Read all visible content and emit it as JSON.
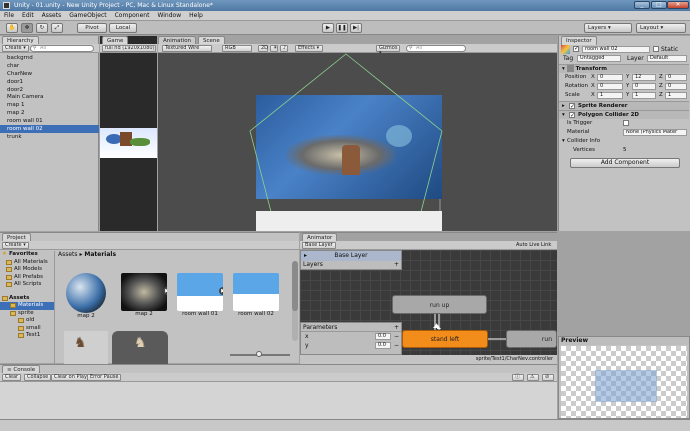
{
  "window": {
    "title": "Unity - 01.unity - New Unity Project - PC, Mac & Linux Standalone*"
  },
  "menu": [
    "File",
    "Edit",
    "Assets",
    "GameObject",
    "Component",
    "Window",
    "Help"
  ],
  "toolbar": {
    "pivot": "Pivot",
    "local": "Local",
    "layers": "Layers",
    "layout": "Layout"
  },
  "hierarchy": {
    "tab": "Hierarchy",
    "create": "Create ▾",
    "search_placeholder": "All",
    "items": [
      "backgrnd",
      "char",
      "CharNew",
      "door1",
      "door2",
      "Main Camera",
      "map 1",
      "map 2",
      "room wall 01",
      "room wall 02",
      "trunk"
    ],
    "selected_index": 9
  },
  "game": {
    "tab": "Game",
    "resolution": "full hd (1920x1080)"
  },
  "scene": {
    "tab_animation": "Animation",
    "tab_scene": "Scene",
    "shading": "Textured Wire",
    "color": "RGB",
    "mode_2d": "2D",
    "effects": "Effects ▾",
    "gizmos": "Gizmos ▾",
    "search_placeholder": "All"
  },
  "inspector": {
    "tab": "Inspector",
    "object_name": "room wall 02",
    "static": "Static",
    "tag_label": "Tag",
    "tag_value": "Untagged",
    "layer_label": "Layer",
    "layer_value": "Default",
    "transform": {
      "title": "Transform",
      "position": {
        "label": "Position",
        "x": "0",
        "y": "12",
        "z": "0"
      },
      "rotation": {
        "label": "Rotation",
        "x": "0",
        "y": "0",
        "z": "0"
      },
      "scale": {
        "label": "Scale",
        "x": "1",
        "y": "1",
        "z": "1"
      }
    },
    "sprite_renderer": "Sprite Renderer",
    "polygon_collider": {
      "title": "Polygon Collider 2D",
      "is_trigger": "Is Trigger",
      "material_label": "Material",
      "material_value": "None (Physics Mater",
      "collider_info": "Collider Info",
      "vertices_label": "Vertices",
      "vertices_value": "5"
    },
    "add_component": "Add Component"
  },
  "project": {
    "tab": "Project",
    "create": "Create ▾",
    "favorites": {
      "title": "Favorites",
      "items": [
        "All Materials",
        "All Models",
        "All Prefabs",
        "All Scripts"
      ]
    },
    "assets": {
      "title": "Assets",
      "items": [
        "Materials",
        "sprite",
        "old",
        "small",
        "Test1"
      ]
    },
    "breadcrumb_root": "Assets",
    "breadcrumb_current": "Materials",
    "asset_items": [
      "map 2",
      "map 2",
      "room wall 01",
      "room wall 02"
    ]
  },
  "animator": {
    "tab": "Animator",
    "base_layer_tab": "Base Layer",
    "auto_live_link": "Auto Live Link",
    "base_layer_row": "Base Layer",
    "layers_label": "Layers",
    "parameters_label": "Parameters",
    "params": [
      {
        "name": "x",
        "value": "0.0"
      },
      {
        "name": "y",
        "value": "0.0"
      }
    ],
    "states": {
      "run_up": "run up",
      "stand_left": "stand left",
      "run_partial": "run"
    },
    "status_path": "sprite/Test1/CharNev.controller"
  },
  "preview": {
    "title": "Preview"
  },
  "console": {
    "tab": "Console",
    "clear": "Clear",
    "collapse": "Collapse",
    "clear_on_play": "Clear on Play",
    "error_pause": "Error Pause"
  },
  "colors": {
    "selection": "#3d6fb7",
    "state_default": "#a8a8a8",
    "state_orange": "#f28c1a",
    "title_bar": "#4f79a3"
  }
}
